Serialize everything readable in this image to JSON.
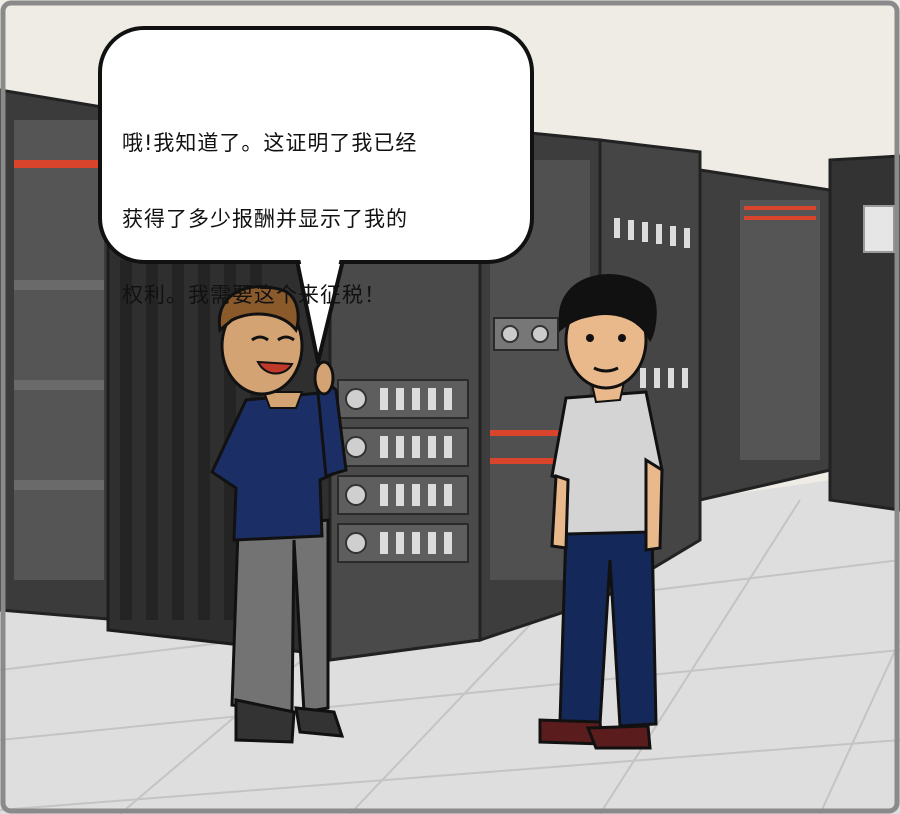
{
  "speech_bubble": {
    "lines": [
      "哦!我知道了。这证明了我已经",
      "获得了多少报酬并显示了我的",
      "权利。我需要这个来征税！"
    ]
  },
  "colors": {
    "wall": "#efece6",
    "floor": "#dcdcdc",
    "rack_dark": "#3a3a3a",
    "rack_mid": "#5a5a5a",
    "accent_red": "#d9442c",
    "shirt_navy": "#1b2f66",
    "shirt_gray": "#d4d4d4",
    "jeans": "#14285a",
    "skin": "#f0c39a"
  }
}
